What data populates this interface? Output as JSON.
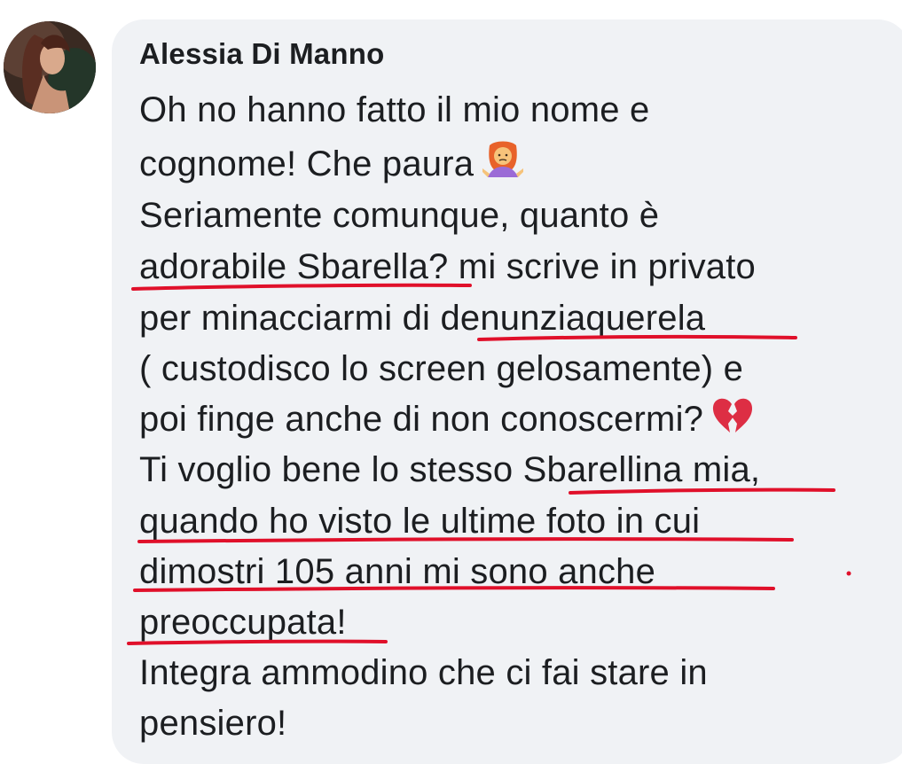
{
  "comment": {
    "author": "Alessia Di Manno",
    "avatar_icon": "profile-photo",
    "lines": [
      "Oh no hanno fatto il mio nome e",
      "cognome! Che paura",
      "Seriamente comunque, quanto è",
      "adorabile Sbarella? mi scrive in privato",
      "per minacciarmi di denunziaquerela",
      "( custodisco lo screen gelosamente) e",
      "poi finge anche di non conoscermi?",
      "Ti voglio bene lo stesso Sbarellina mia,",
      "quando ho visto le ultime foto in cui",
      "dimostri 105 anni mi sono anche",
      "preoccupata!",
      "Integra ammodino che ci fai stare in",
      "pensiero!"
    ],
    "emojis": {
      "line_2": "person-shrugging-emoji",
      "line_7": "broken-heart-emoji"
    }
  },
  "colors": {
    "bubble_bg": "#f0f2f5",
    "text": "#1c1e21",
    "underline": "#e0102a"
  }
}
